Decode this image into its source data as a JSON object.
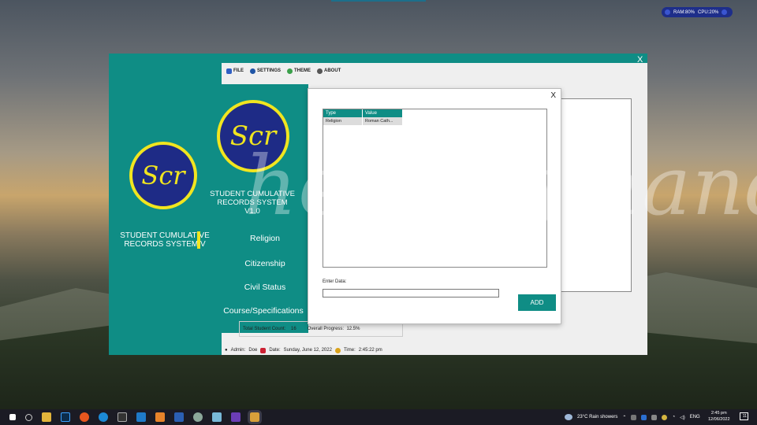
{
  "system_monitor": {
    "ram": "RAM:80%",
    "cpu": "CPU:20%"
  },
  "background_window": {
    "minimize": "_",
    "close": "X",
    "app_name": "STUDENT CUMULATIVE RECORDS SYSTEM V",
    "logo_text": "Scr"
  },
  "main_window": {
    "menu": [
      {
        "label": "FILE",
        "icon": "file-icon",
        "color": "#2f5fc4"
      },
      {
        "label": "SETTINGS",
        "icon": "gear-icon",
        "color": "#1f55a6"
      },
      {
        "label": "THEME",
        "icon": "palette-icon",
        "color": "#3aa04a"
      },
      {
        "label": "ABOUT",
        "icon": "info-icon",
        "color": "#555555"
      }
    ],
    "logo_text": "Scr",
    "app_name_line1": "STUDENT CUMULATIVE",
    "app_name_line2": "RECORDS SYSTEM V1.0",
    "nav": [
      "Religion",
      "Citizenship",
      "Civil Status",
      "Course/Specifications"
    ],
    "stats": {
      "count_label": "Total Student Count:",
      "count_value": "16",
      "progress_label": "Overall Progress:",
      "progress_value": "12.5%"
    },
    "status": {
      "admin_label": "Admin:",
      "admin_value": "Doe",
      "date_label": "Date:",
      "date_value": "Sunday, June 12, 2022",
      "time_label": "Time:",
      "time_value": "2:45:22 pm"
    }
  },
  "dialog": {
    "close": "X",
    "columns": [
      "Type",
      "Value"
    ],
    "rows": [
      {
        "type": "Religion",
        "value": "Roman Cath..."
      }
    ],
    "enter_label": "Enter Data:",
    "input_value": "",
    "add_button": "ADD"
  },
  "watermark": "helping hand",
  "taskbar": {
    "weather": "23°C  Rain showers",
    "lang": "ENG",
    "time": "2:45 pm",
    "date": "12/06/2022",
    "notification_count": "11"
  },
  "colors": {
    "teal": "#0f8d85",
    "logo_navy": "#1e2b86",
    "logo_yellow": "#f1e51f"
  }
}
